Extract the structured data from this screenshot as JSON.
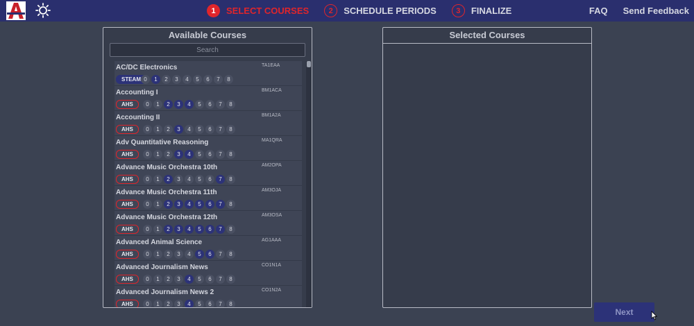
{
  "header": {
    "steps": [
      {
        "num": "1",
        "label": "SELECT COURSES",
        "active": true
      },
      {
        "num": "2",
        "label": "SCHEDULE PERIODS",
        "active": false
      },
      {
        "num": "3",
        "label": "FINALIZE",
        "active": false
      }
    ],
    "links": [
      "FAQ",
      "Send Feedback"
    ],
    "logo_icon": "school-a-logo",
    "theme_icon": "sun-icon"
  },
  "available": {
    "title": "Available Courses",
    "search_placeholder": "Search",
    "courses": [
      {
        "name": "AC/DC Electronics",
        "code": "TA1EAA",
        "tag": "STEAM",
        "active_periods": [
          1
        ]
      },
      {
        "name": "Accounting I",
        "code": "BM1ACA",
        "tag": "AHS",
        "active_periods": [
          2,
          3,
          4
        ]
      },
      {
        "name": "Accounting II",
        "code": "BM1A2A",
        "tag": "AHS",
        "active_periods": [
          3
        ]
      },
      {
        "name": "Adv Quantitative Reasoning",
        "code": "MA1QRA",
        "tag": "AHS",
        "active_periods": [
          3,
          4
        ]
      },
      {
        "name": "Advance Music Orchestra 10th",
        "code": "AM2OPA",
        "tag": "AHS",
        "active_periods": [
          2,
          7
        ]
      },
      {
        "name": "Advance Music Orchestra 11th",
        "code": "AM3OJA",
        "tag": "AHS",
        "active_periods": [
          2,
          3,
          4,
          5,
          6,
          7
        ]
      },
      {
        "name": "Advance Music Orchestra 12th",
        "code": "AM3OSA",
        "tag": "AHS",
        "active_periods": [
          2,
          3,
          4,
          5,
          6,
          7
        ]
      },
      {
        "name": "Advanced Animal Science",
        "code": "AG1AAA",
        "tag": "AHS",
        "active_periods": [
          5,
          6
        ]
      },
      {
        "name": "Advanced Journalism News",
        "code": "CO1N1A",
        "tag": "AHS",
        "active_periods": [
          4
        ]
      },
      {
        "name": "Advanced Journalism News 2",
        "code": "CO1N2A",
        "tag": "AHS",
        "active_periods": [
          4
        ]
      }
    ],
    "period_labels": [
      "0",
      "1",
      "2",
      "3",
      "4",
      "5",
      "6",
      "7",
      "8"
    ]
  },
  "selected": {
    "title": "Selected Courses",
    "courses": []
  },
  "footer": {
    "next_label": "Next"
  },
  "colors": {
    "header_bg": "#2a2f6e",
    "accent_red": "#e0252b",
    "period_active": "#2c3278",
    "page_bg": "#3b4252"
  }
}
